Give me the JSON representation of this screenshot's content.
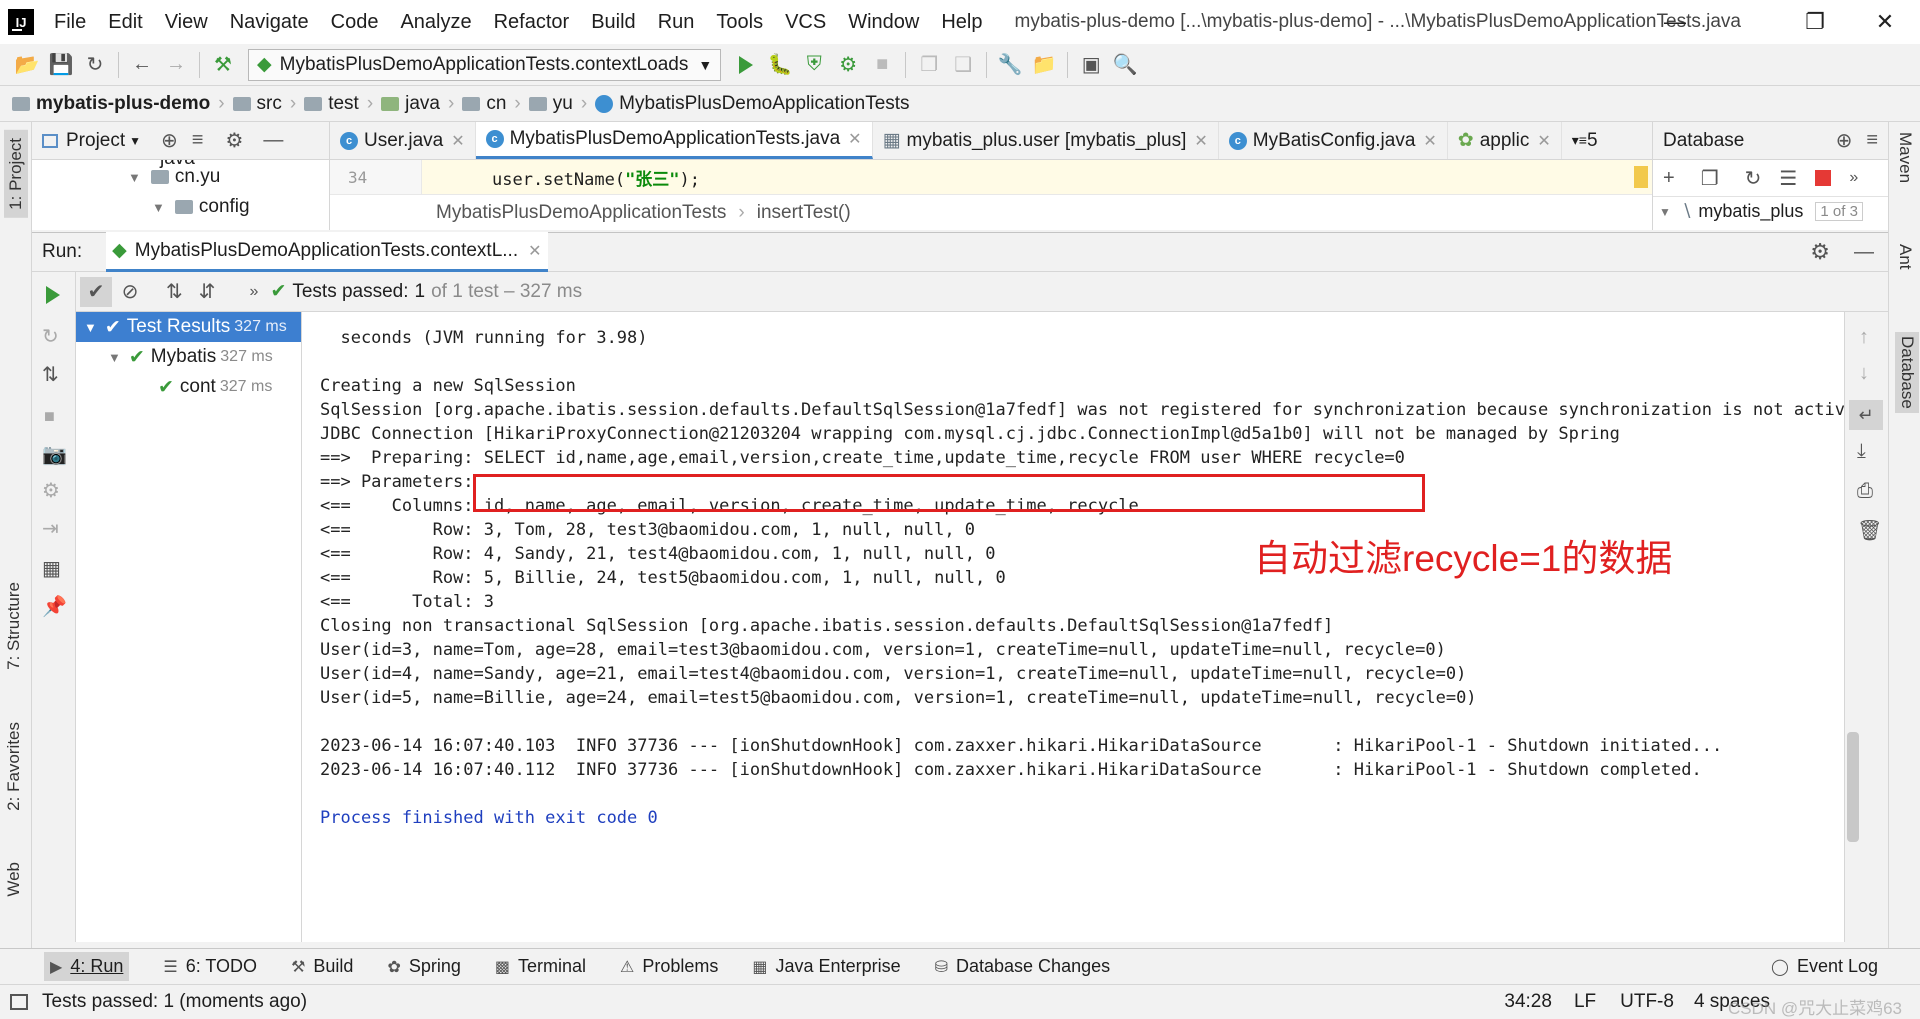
{
  "menu": {
    "items": [
      "File",
      "Edit",
      "View",
      "Navigate",
      "Code",
      "Analyze",
      "Refactor",
      "Build",
      "Run",
      "Tools",
      "VCS",
      "Window",
      "Help"
    ],
    "window_title": "mybatis-plus-demo [...\\mybatis-plus-demo] - ...\\MybatisPlusDemoApplicationTests.java",
    "logo": "IJ"
  },
  "toolbar": {
    "run_config": "MybatisPlusDemoApplicationTests.contextLoads"
  },
  "breadcrumb": {
    "items": [
      "mybatis-plus-demo",
      "src",
      "test",
      "java",
      "cn",
      "yu",
      "MybatisPlusDemoApplicationTests"
    ]
  },
  "left_stripe": {
    "project": "1: Project",
    "structure": "7: Structure",
    "favorites": "2: Favorites",
    "web": "Web"
  },
  "right_stripe": {
    "maven": "Maven",
    "ant": "Ant",
    "database": "Database"
  },
  "project_panel": {
    "title": "Project",
    "tree": [
      {
        "label": "java"
      },
      {
        "label": "cn.yu"
      },
      {
        "label": "config"
      }
    ]
  },
  "editor": {
    "tabs": [
      {
        "label": "User.java"
      },
      {
        "label": "MybatisPlusDemoApplicationTests.java"
      },
      {
        "label": "mybatis_plus.user [mybatis_plus]"
      },
      {
        "label": "MyBatisConfig.java"
      },
      {
        "label": "applic"
      }
    ],
    "overflow": "5",
    "line_number": "34",
    "code_prefix": "user.setName(",
    "code_string": "\"张三\"",
    "code_suffix": ");",
    "crumb_class": "MybatisPlusDemoApplicationTests",
    "crumb_method": "insertTest()"
  },
  "database_panel": {
    "title": "Database",
    "item": "mybatis_plus",
    "count": "1 of 3"
  },
  "run_panel": {
    "label": "Run:",
    "tab": "MybatisPlusDemoApplicationTests.contextL..."
  },
  "tests": {
    "status_prefix": "Tests passed:",
    "passed": "1",
    "status_suffix": "of 1 test – 327 ms",
    "tree": [
      {
        "label": "Test Results",
        "time": "327 ms"
      },
      {
        "label": "Mybatis",
        "time": "327 ms"
      },
      {
        "label": "cont",
        "time": "327 ms"
      }
    ]
  },
  "console": {
    "lines": [
      "  seconds (JVM running for 3.98)",
      "",
      "Creating a new SqlSession",
      "SqlSession [org.apache.ibatis.session.defaults.DefaultSqlSession@1a7fedf] was not registered for synchronization because synchronization is not active",
      "JDBC Connection [HikariProxyConnection@21203204 wrapping com.mysql.cj.jdbc.ConnectionImpl@d5a1b0] will not be managed by Spring",
      "==>  Preparing: SELECT id,name,age,email,version,create_time,update_time,recycle FROM user WHERE recycle=0",
      "==> Parameters: ",
      "<==    Columns: id, name, age, email, version, create_time, update_time, recycle",
      "<==        Row: 3, Tom, 28, test3@baomidou.com, 1, null, null, 0",
      "<==        Row: 4, Sandy, 21, test4@baomidou.com, 1, null, null, 0",
      "<==        Row: 5, Billie, 24, test5@baomidou.com, 1, null, null, 0",
      "<==      Total: 3",
      "Closing non transactional SqlSession [org.apache.ibatis.session.defaults.DefaultSqlSession@1a7fedf]",
      "User(id=3, name=Tom, age=28, email=test3@baomidou.com, version=1, createTime=null, updateTime=null, recycle=0)",
      "User(id=4, name=Sandy, age=21, email=test4@baomidou.com, version=1, createTime=null, updateTime=null, recycle=0)",
      "User(id=5, name=Billie, age=24, email=test5@baomidou.com, version=1, createTime=null, updateTime=null, recycle=0)",
      "",
      "2023-06-14 16:07:40.103  INFO 37736 --- [ionShutdownHook] com.zaxxer.hikari.HikariDataSource       : HikariPool-1 - Shutdown initiated...",
      "2023-06-14 16:07:40.112  INFO 37736 --- [ionShutdownHook] com.zaxxer.hikari.HikariDataSource       : HikariPool-1 - Shutdown completed.",
      "",
      "Process finished with exit code 0"
    ],
    "annotation": "自动过滤recycle=1的数据"
  },
  "bottom_tabs": [
    {
      "label": "4: Run"
    },
    {
      "label": "6: TODO"
    },
    {
      "label": "Build"
    },
    {
      "label": "Spring"
    },
    {
      "label": "Terminal"
    },
    {
      "label": "Problems"
    },
    {
      "label": "Java Enterprise"
    },
    {
      "label": "Database Changes"
    }
  ],
  "event_log": "Event Log",
  "status": {
    "message": "Tests passed: 1 (moments ago)",
    "position": "34:28",
    "line_sep": "LF",
    "encoding": "UTF-8",
    "indent": "4 spaces"
  },
  "watermark": "CSDN @咒大止菜鸡63",
  "colors": {
    "accent": "#4083c9",
    "success": "#3a9a3a",
    "annotation": "#e02020"
  }
}
